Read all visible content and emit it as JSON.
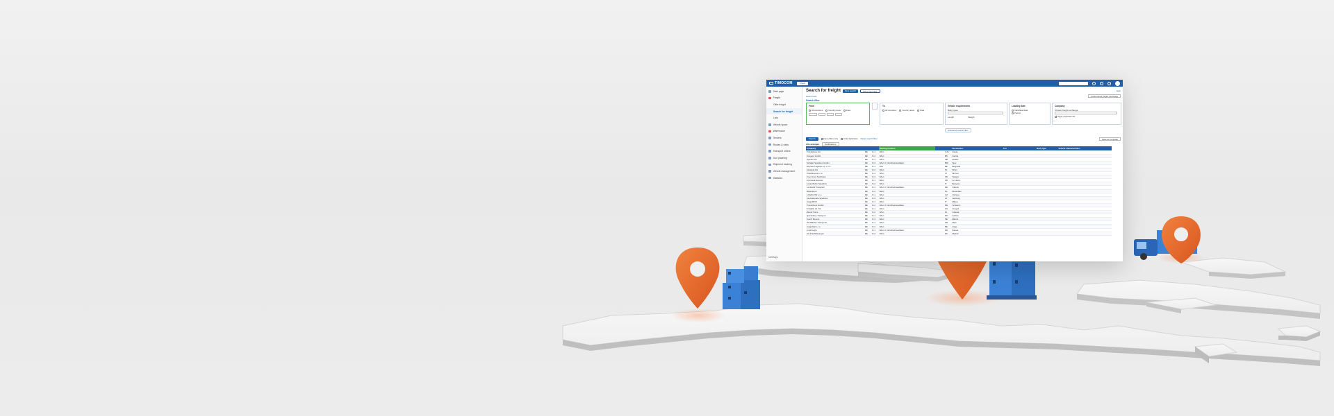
{
  "app": {
    "brand": "TIMOCOM",
    "top_chip": "Check",
    "help": "Help"
  },
  "sidebar": {
    "items": [
      {
        "label": "Start page",
        "icon": "home-icon",
        "sub": false,
        "active": false
      },
      {
        "label": "Freight",
        "icon": "freight-icon",
        "sub": false,
        "active": false,
        "red": true
      },
      {
        "label": "Offer freight",
        "icon": "",
        "sub": true,
        "active": false
      },
      {
        "label": "Search for freight",
        "icon": "",
        "sub": true,
        "active": true
      },
      {
        "label": "Lists",
        "icon": "",
        "sub": true,
        "active": false
      },
      {
        "label": "Vehicle space",
        "icon": "truck-icon",
        "sub": false,
        "active": false
      },
      {
        "label": "Warehouse",
        "icon": "warehouse-icon",
        "sub": false,
        "active": false,
        "red": true
      },
      {
        "label": "Tenders",
        "icon": "tenders-icon",
        "sub": false,
        "active": false
      },
      {
        "label": "Routes & visits",
        "icon": "route-icon",
        "sub": false,
        "active": false
      },
      {
        "label": "Transport orders",
        "icon": "orders-icon",
        "sub": false,
        "active": false
      },
      {
        "label": "Tour planning",
        "icon": "planning-icon",
        "sub": false,
        "active": false
      },
      {
        "label": "Shipment tracking",
        "icon": "tracking-icon",
        "sub": false,
        "active": false
      },
      {
        "label": "Vehicle management",
        "icon": "vehicle-icon",
        "sub": false,
        "active": false
      },
      {
        "label": "Statistics",
        "icon": "stats-icon",
        "sub": false,
        "active": false
      }
    ],
    "bottom": "Overlays"
  },
  "main": {
    "title": "Search for freight",
    "new_search": "New search",
    "select_template": "Select template",
    "learn_more": "Learn more",
    "exchange_btn": "Customized freight exchange",
    "search_filter": "Search filter",
    "filters": {
      "from_title": "From",
      "to_title": "To",
      "vehicle_title": "Vehicle requirements",
      "loading_title": "Loading date",
      "company_title": "Company",
      "all_countries": "All countries",
      "country_area": "Country area",
      "area": "Area",
      "body_types": "Body types",
      "length": "Length",
      "weight": "Weight",
      "individual_date": "Individual date",
      "period": "Period",
      "chosen_exchange": "Chosen freight exchange",
      "apply_exclusion": "Apply exclusion list",
      "advanced": "Advanced search filter"
    },
    "actions": {
      "search": "Search",
      "new_offers_only": "New offers only",
      "hide_duplicates": "Hide duplicates",
      "reset": "Reset search filter",
      "save_template": "Save as template"
    },
    "results": {
      "label": "Alle anzeigen",
      "chip": "Notifications"
    },
    "table": {
      "headers": [
        "Company",
        "",
        "",
        "Starting location",
        "",
        "",
        "Destination",
        "Ton",
        "",
        "",
        "",
        "Body type",
        "Vehicle characteristics",
        "",
        ""
      ],
      "rows": [
        [
          "TransMovie AG",
          "DE",
          "D-1",
          "Wien",
          "JUS",
          "Lleida"
        ],
        [
          "Kongera GmbH",
          "DE",
          "D-2",
          "Wien",
          "BS",
          "Gierde"
        ],
        [
          "Spedex KG",
          "DE",
          "D-1",
          "Wien",
          "SB",
          "Pfeiffer"
        ],
        [
          "Schaller Spedition GmbH",
          "DE",
          "D-3",
          "Wien 3, Nordrheinwestfalen",
          "BW",
          "Sper"
        ],
        [
          "Express Logistics sp. z o.o.",
          "DE",
          "D-1",
          "Ros",
          "BE",
          "Belgrade"
        ],
        [
          "Intralong AG",
          "DE",
          "D-2",
          "Wien",
          "PL",
          "Winni"
        ],
        [
          "PolarMovers s.r.o.",
          "DE",
          "D-1",
          "Wien",
          "LT",
          "Nidrum"
        ],
        [
          "Frey Cross Nordtrans",
          "DE",
          "D-3",
          "Wien",
          "FR",
          "Tarajon"
        ],
        [
          "Formania Express",
          "DE",
          "D-1",
          "Wien",
          "FR",
          "Le Havre"
        ],
        [
          "Lucas Bohm Spedition",
          "DE",
          "D-2",
          "Wien",
          "IT",
          "Bologna"
        ],
        [
          "Lombardi Transporti",
          "DE",
          "D-1",
          "Wien 3, Nordrheinwestfalen",
          "DE",
          "Lübeck"
        ],
        [
          "despebend",
          "DE",
          "D-2",
          "Wien",
          "NL",
          "Rotterdam"
        ],
        [
          "LOGIFLOW s.r.o.",
          "DE",
          "D-1",
          "Wien",
          "CZ",
          "Ostrava"
        ],
        [
          "Internationale Spedition",
          "DE",
          "D-3",
          "Wien",
          "AT",
          "Salzburg"
        ],
        [
          "CargoMIXX",
          "DE",
          "D-1",
          "Wien",
          "IT",
          "Milano"
        ],
        [
          "TransOrient GmbH",
          "DE",
          "D-2",
          "Wien 3, Nordrheinwestfalen",
          "DE",
          "Schwerin"
        ],
        [
          "Freightly Int. KG",
          "DE",
          "D-1",
          "Wien",
          "HU",
          "Szeged"
        ],
        [
          "Wendt Trans",
          "DE",
          "D-2",
          "Wien",
          "PL",
          "Gdansk"
        ],
        [
          "Quicksbury Transport",
          "DE",
          "D-1",
          "Wien",
          "DK",
          "Aarhus"
        ],
        [
          "Kusch Movers",
          "DE",
          "D-3",
          "Wien",
          "SE",
          "Malmö"
        ],
        [
          "MAJER AG Transporte",
          "DE",
          "D-1",
          "Wien",
          "FR",
          "Metz"
        ],
        [
          "CargoStar s.r.o.",
          "DE",
          "D-2",
          "Wien",
          "BE",
          "Liège"
        ],
        [
          "LineFreight",
          "DE",
          "D-1",
          "Wien 3, Nordrheinwestfalen",
          "DE",
          "Kassel"
        ],
        [
          "AG Frachtlösungen",
          "DE",
          "D-2",
          "Wien",
          "ES",
          "Madrid"
        ]
      ]
    }
  },
  "colors": {
    "brand": "#1f5ea8",
    "accent_green": "#3aa84a",
    "pin": "#e8692e",
    "box": "#3b82d6"
  }
}
